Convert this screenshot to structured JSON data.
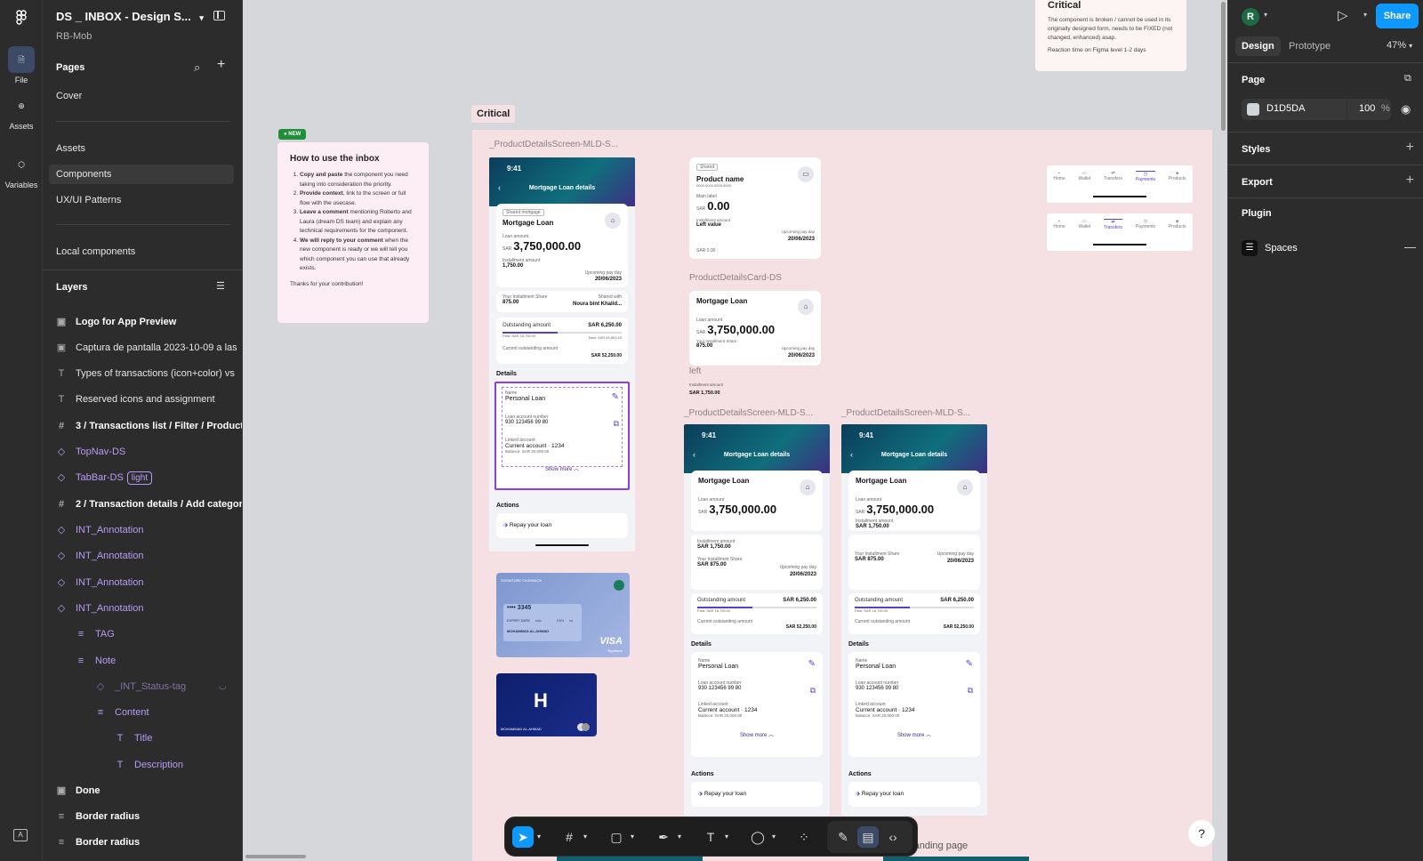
{
  "file": {
    "title": "DS _ INBOX - Design S...",
    "subtitle": "RB-Mob"
  },
  "rail": [
    {
      "label": "File",
      "icon": "file-icon"
    },
    {
      "label": "Assets",
      "icon": "assets-icon"
    },
    {
      "label": "Variables",
      "icon": "variables-icon"
    }
  ],
  "pages": {
    "header": "Pages",
    "items": [
      "Cover",
      "Assets",
      "Components",
      "UX/UI Patterns",
      "Local components"
    ]
  },
  "layers": {
    "header": "Layers",
    "items": [
      {
        "label": "Logo for App Preview",
        "kind": "image"
      },
      {
        "label": "Captura de pantalla 2023-10-09 a las",
        "kind": "image"
      },
      {
        "label": "Types of transactions (icon+color) vs",
        "kind": "text"
      },
      {
        "label": "Reserved icons and assignment",
        "kind": "text"
      },
      {
        "label": "3 / Transactions list / Filter / Product",
        "kind": "frame"
      },
      {
        "label": "TopNav-DS",
        "kind": "component"
      },
      {
        "label": "TabBar-DS",
        "kind": "component",
        "tag": "light"
      },
      {
        "label": "2 / Transaction details / Add category",
        "kind": "frame"
      },
      {
        "label": "INT_Annotation",
        "kind": "component"
      },
      {
        "label": "INT_Annotation",
        "kind": "component"
      },
      {
        "label": "INT_Annotation",
        "kind": "component"
      },
      {
        "label": "INT_Annotation",
        "kind": "component"
      },
      {
        "label": "TAG",
        "kind": "autolayout"
      },
      {
        "label": "Note",
        "kind": "autolayout"
      },
      {
        "label": "_INT_Status-tag",
        "kind": "instance"
      },
      {
        "label": "Content",
        "kind": "autolayout"
      },
      {
        "label": "Title",
        "kind": "text"
      },
      {
        "label": "Description",
        "kind": "text"
      },
      {
        "label": "Done",
        "kind": "image"
      },
      {
        "label": "Border radius",
        "kind": "autolayout"
      },
      {
        "label": "Border radius",
        "kind": "autolayout"
      }
    ]
  },
  "header": {
    "avatar": "R",
    "share": "Share",
    "tabs": [
      "Design",
      "Prototype"
    ],
    "zoom": "47%"
  },
  "props": {
    "page": "Page",
    "color": "D1D5DA",
    "opacity": "100",
    "pct": "%",
    "styles": "Styles",
    "export": "Export",
    "plugin": "Plugin",
    "spaces": "Spaces"
  },
  "canvas": {
    "critical_tag": "Critical",
    "critical_note": {
      "title": "Critical",
      "body": "The component is broken / cannot be used in its originally designed form, needs to be FIXED (not changed, enhanced) asap.",
      "reaction": "Reaction time on Figma level 1-2 days"
    },
    "inbox_note": {
      "badge": "NEW",
      "title": "How to use the inbox",
      "steps": [
        {
          "b": "Copy and paste",
          "t": " the component you need taking into consideration the priority."
        },
        {
          "b": "Provide context",
          "t": ", link to the screen or full flow with the usecase."
        },
        {
          "b": "Leave a comment",
          "t": " mentioning Roberto and Laura (dream DS team) and explain any technical requirements for the component."
        },
        {
          "b": "We will reply to your comment",
          "t": " when the new component is ready or we will tell you which component you can use that already exists."
        }
      ],
      "thanks": "Thanks for your contribution!"
    },
    "frame_label": "_ProductDetailsScreen-MLD-S...",
    "card_label": "ProductDetailsCard-DS",
    "left_label": "left",
    "landing_label": "e landing page",
    "phone": {
      "time": "9:41",
      "nav": "Mortgage Loan details",
      "shared": "Shared mortgage",
      "title": "Mortgage Loan",
      "loan_label": "Loan amount",
      "cur": "SAR",
      "loan": "3,750,000.00",
      "inst_label": "Installment amount",
      "inst": "1,750.00",
      "pay_label": "Upcoming pay day",
      "pay": "20/06/2023",
      "share_label": "Your Installment Share",
      "share": "875.00",
      "with_label": "Shared with",
      "with": "Noura bint Khalid...",
      "out_label": "Outstanding amount",
      "out": "SAR 6,250.00",
      "paid": "Paid: SAR 18,750.00",
      "total": "Total: SAR 63,800.15",
      "cur_out_label": "Current outstanding amount",
      "cur_out": "SAR 52,250.00",
      "details": "Details",
      "name_label": "Name",
      "name": "Personal Loan",
      "acc_label": "Loan account number",
      "acc": "930 123456 99 80",
      "linked_label": "Linked account",
      "linked": "Current account · 1234",
      "balance": "Balance: SAR 20,000.00",
      "show_more": "Show more",
      "actions": "Actions",
      "repay": "Repay your loan"
    },
    "product_card": {
      "tag": "Shared",
      "title": "Product name",
      "num": "0000.0000.0000.0000",
      "main": "Main label",
      "amt": "0.00",
      "inst_label": "Installment amount",
      "left": "Left value",
      "pay_label": "Upcoming pay day",
      "pay": "20/06/2023",
      "bottom": "0.00"
    },
    "card_visa": {
      "masked": "•••• 3345",
      "expiry": "EXPIRY DATE",
      "expiry_v": "••/••",
      "cvv": "CVV",
      "cvv_v": "•••",
      "holder": "MOHAMMAD AL-AHMAD",
      "brand": "VISA",
      "sub": "Signature",
      "program": "SIGNATURE CASHBACK"
    },
    "card_alhilal": {
      "holder": "MOHAMMAD AL-AHMAD"
    },
    "tabbar": [
      "Home",
      "Wallet",
      "Transfers",
      "Payments",
      "Products"
    ]
  },
  "colors": {
    "accent": "#0d99ff",
    "purple": "#7b3fe4",
    "pink_bg": "#f5e1e3"
  }
}
